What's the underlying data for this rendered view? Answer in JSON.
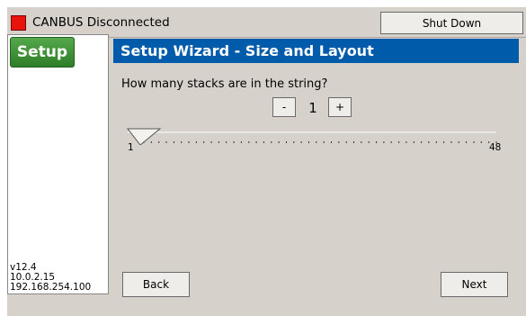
{
  "status": {
    "text": "CANBUS Disconnected",
    "led_color": "#e8140c"
  },
  "toolbar": {
    "shutdown_label": "Shut Down"
  },
  "sidebar": {
    "tab_label": "Setup",
    "version": "v12.4",
    "ip_1": "10.0.2.15",
    "ip_2": "192.168.254.100"
  },
  "header": {
    "title": "Setup Wizard - Size and Layout"
  },
  "question": {
    "text": "How many stacks are in the string?"
  },
  "stepper": {
    "minus_label": "-",
    "value": "1",
    "plus_label": "+"
  },
  "slider": {
    "min_label": "1",
    "max_label": "48",
    "min": 1,
    "max": 48,
    "value": 1
  },
  "nav": {
    "back_label": "Back",
    "next_label": "Next"
  }
}
